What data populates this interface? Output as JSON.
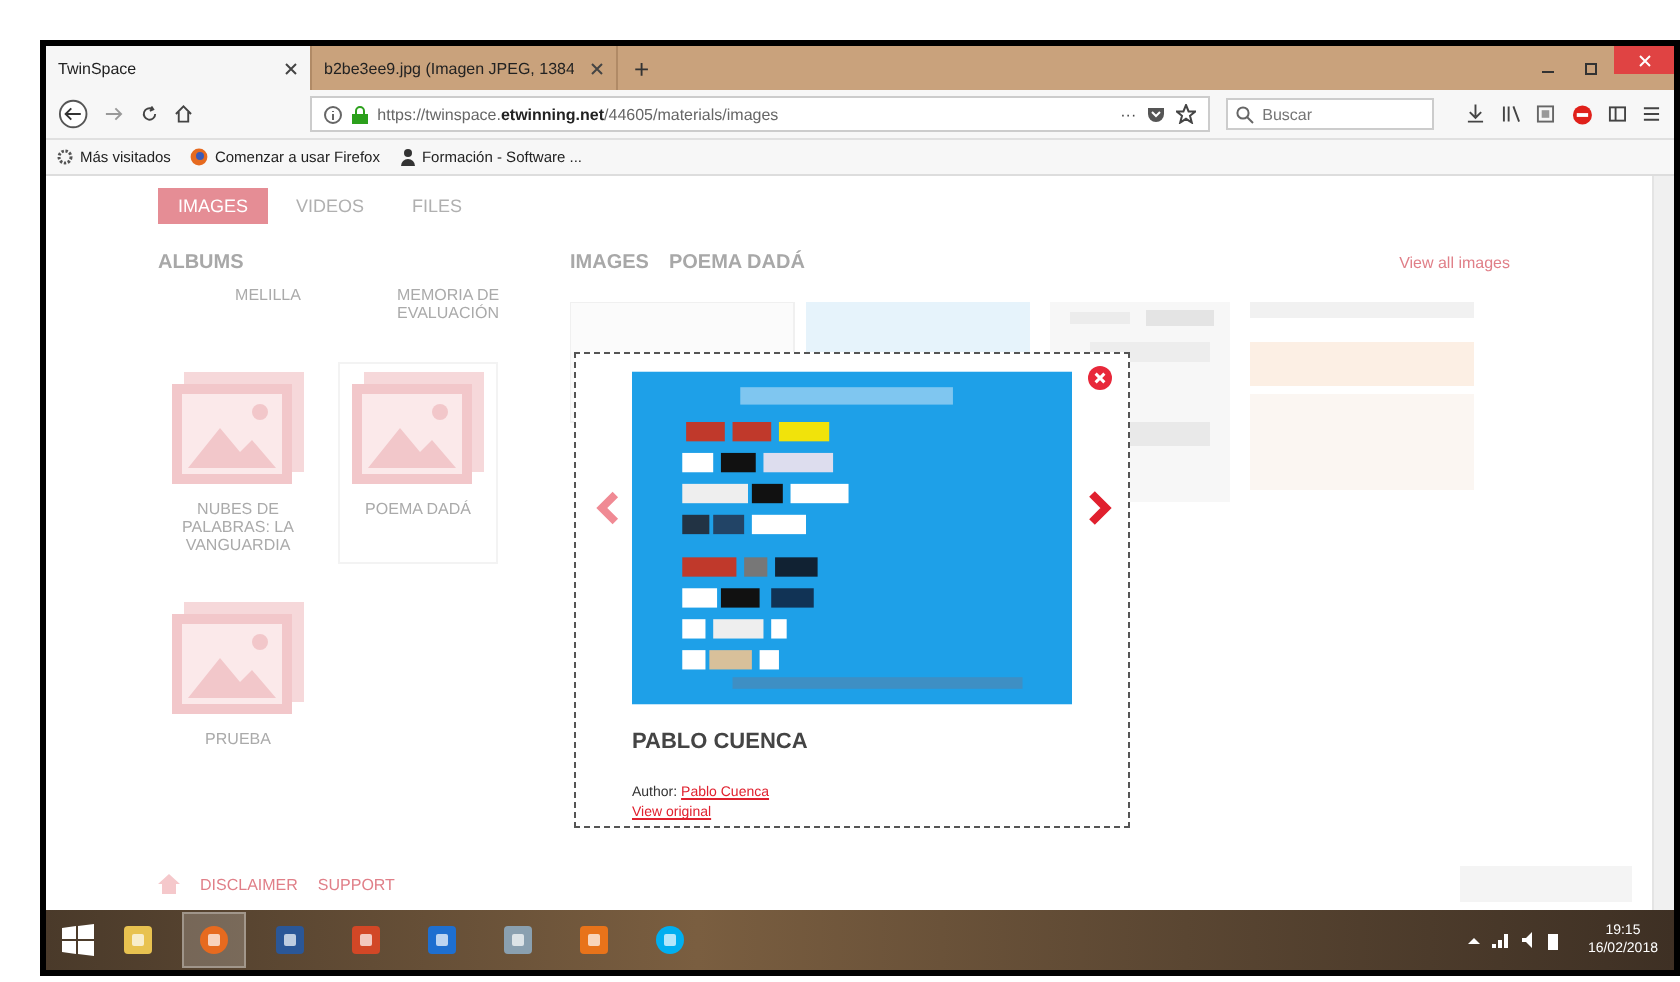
{
  "browser": {
    "tabs": [
      {
        "label": "TwinSpace",
        "selected": true
      },
      {
        "label": "b2be3ee9.jpg (Imagen JPEG, 1384",
        "selected": false
      }
    ],
    "new_tab": "+",
    "url": {
      "prefix": "https://twinspace.",
      "domain": "etwinning.net",
      "path": "/44605/materials/images"
    },
    "page_actions": "···",
    "search": {
      "placeholder": "Buscar"
    },
    "bookmarks": [
      {
        "label": "Más visitados",
        "kind": "gear"
      },
      {
        "label": "Comenzar a usar Firefox",
        "kind": "firefox"
      },
      {
        "label": "Formación - Software ...",
        "kind": "person"
      }
    ]
  },
  "page": {
    "tabs": [
      {
        "label": "IMAGES",
        "selected": true
      },
      {
        "label": "VIDEOS",
        "selected": false
      },
      {
        "label": "FILES",
        "selected": false
      }
    ],
    "albums_title": "ALBUMS",
    "albums_cut_off": [
      "MELILLA",
      "MEMORIA DE EVALUACIÓN"
    ],
    "albums": [
      {
        "name": "NUBES DE PALABRAS: LA VANGUARDIA",
        "selected": false
      },
      {
        "name": "POEMA DADÁ",
        "selected": true
      },
      {
        "name": "PRUEBA",
        "selected": false
      }
    ],
    "images_title": "IMAGES",
    "album_title": "POEMA DADÁ",
    "view_all": "View all images",
    "footer_links": [
      "DISCLAIMER",
      "SUPPORT"
    ]
  },
  "lightbox": {
    "title": "PABLO CUENCA",
    "author_label": "Author:",
    "author": "Pablo Cuenca",
    "view_original": "View original"
  },
  "taskbar": {
    "apps": [
      {
        "kind": "explorer",
        "active": false
      },
      {
        "kind": "firefox",
        "active": true
      },
      {
        "kind": "word",
        "active": false
      },
      {
        "kind": "powerpoint",
        "active": false
      },
      {
        "kind": "scanner",
        "active": false
      },
      {
        "kind": "paint",
        "active": false
      },
      {
        "kind": "orange",
        "active": false
      },
      {
        "kind": "skype",
        "active": false
      }
    ],
    "time": "19:15",
    "date": "16/02/2018"
  }
}
